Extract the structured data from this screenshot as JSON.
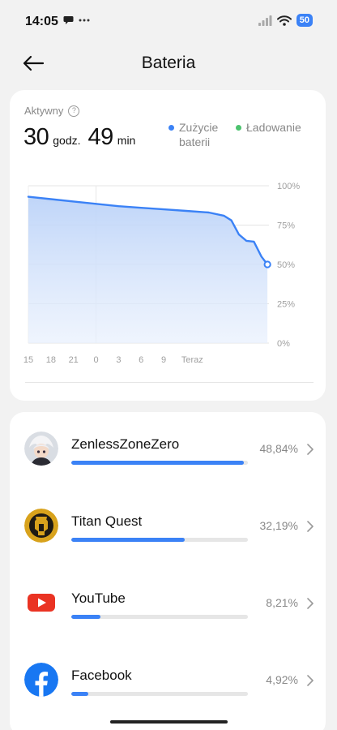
{
  "status_bar": {
    "time": "14:05",
    "battery_level": "50",
    "icons": [
      "chat-icon",
      "more-dots-icon",
      "signal-icon",
      "wifi-icon",
      "battery-icon"
    ]
  },
  "header": {
    "title": "Bateria",
    "back_icon": "back-arrow-icon"
  },
  "summary": {
    "active_label": "Aktywny",
    "hours_value": "30",
    "hours_unit": "godz.",
    "minutes_value": "49",
    "minutes_unit": "min",
    "legend": [
      {
        "label": "Zużycie baterii",
        "color": "#3b82f6"
      },
      {
        "label": "Ładowanie",
        "color": "#4cc36e"
      }
    ]
  },
  "chart_data": {
    "type": "area",
    "x_tick_labels": [
      "15",
      "18",
      "21",
      "0",
      "3",
      "6",
      "9",
      "Teraz"
    ],
    "y_tick_labels": [
      "100%",
      "75%",
      "50%",
      "25%",
      "0%"
    ],
    "ylim": [
      0,
      100
    ],
    "grid": true,
    "series": [
      {
        "name": "Zużycie baterii",
        "color": "#3b82f6",
        "points": [
          [
            0,
            93
          ],
          [
            3,
            91.5
          ],
          [
            6,
            90
          ],
          [
            9,
            88.5
          ],
          [
            12,
            87
          ],
          [
            15,
            86
          ],
          [
            18,
            85
          ],
          [
            21,
            84
          ],
          [
            24,
            83
          ],
          [
            26,
            81
          ],
          [
            27,
            78
          ],
          [
            28,
            69
          ],
          [
            29,
            65
          ],
          [
            30,
            64.5
          ],
          [
            31,
            55
          ],
          [
            31.8,
            50
          ]
        ]
      }
    ],
    "x_range": [
      0,
      32
    ],
    "x_tick_values": [
      0,
      3,
      6,
      9,
      12,
      15,
      18,
      21.8
    ]
  },
  "apps": [
    {
      "name": "ZenlessZoneZero",
      "percent_label": "48,84%",
      "percent": 48.84,
      "icon": "zenless-zone-zero-app-icon"
    },
    {
      "name": "Titan Quest",
      "percent_label": "32,19%",
      "percent": 32.19,
      "icon": "titan-quest-app-icon"
    },
    {
      "name": "YouTube",
      "percent_label": "8,21%",
      "percent": 8.21,
      "icon": "youtube-app-icon"
    },
    {
      "name": "Facebook",
      "percent_label": "4,92%",
      "percent": 4.92,
      "icon": "facebook-app-icon"
    }
  ],
  "colors": {
    "accent": "#3b82f6",
    "charging": "#4cc36e",
    "background": "#f2f2f2",
    "card": "#ffffff"
  }
}
